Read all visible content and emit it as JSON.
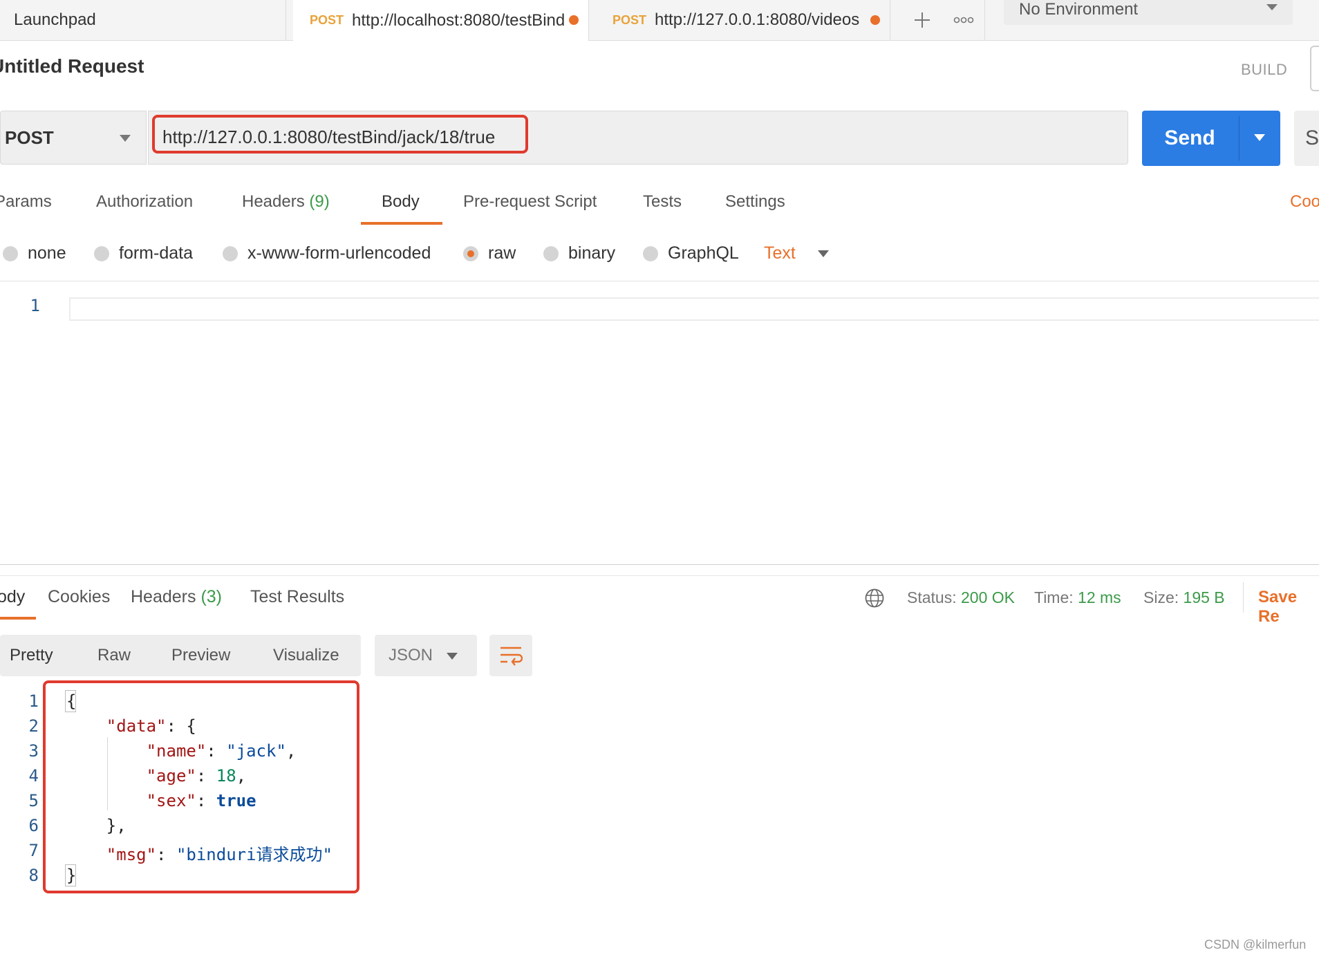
{
  "tabs": {
    "launchpad": "Launchpad",
    "items": [
      {
        "method": "POST",
        "url": "http://localhost:8080/testBind"
      },
      {
        "method": "POST",
        "url": "http://127.0.0.1:8080/videos"
      }
    ],
    "add_icon": "+",
    "more_icon": "ooo"
  },
  "environment": {
    "selected": "No Environment"
  },
  "request": {
    "title": "Untitled Request",
    "build_label": "BUILD",
    "method": "POST",
    "url": "http://127.0.0.1:8080/testBind/jack/18/true",
    "send_label": "Send",
    "save_label": "Sa",
    "tabs": [
      {
        "label": "Params"
      },
      {
        "label": "Authorization"
      },
      {
        "label": "Headers",
        "count": "(9)"
      },
      {
        "label": "Body"
      },
      {
        "label": "Pre-request Script"
      },
      {
        "label": "Tests"
      },
      {
        "label": "Settings"
      }
    ],
    "active_tab": "Body",
    "cookies_link": "Coo",
    "body_types": [
      "none",
      "form-data",
      "x-www-form-urlencoded",
      "raw",
      "binary",
      "GraphQL"
    ],
    "selected_body_type": "raw",
    "raw_format": "Text",
    "editor_line_numbers": [
      "1"
    ]
  },
  "response": {
    "tabs": [
      {
        "label": "ody"
      },
      {
        "label": "Cookies"
      },
      {
        "label": "Headers",
        "count": "(3)"
      },
      {
        "label": "Test Results"
      }
    ],
    "status_label": "Status:",
    "status_value": "200 OK",
    "time_label": "Time:",
    "time_value": "12 ms",
    "size_label": "Size:",
    "size_value": "195 B",
    "save_label": "Save Re",
    "views": [
      "Pretty",
      "Raw",
      "Preview",
      "Visualize"
    ],
    "active_view": "Pretty",
    "format": "JSON",
    "line_numbers": [
      "1",
      "2",
      "3",
      "4",
      "5",
      "6",
      "7",
      "8"
    ],
    "body": {
      "key_data": "\"data\"",
      "key_name": "\"name\"",
      "val_name": "\"jack\"",
      "key_age": "\"age\"",
      "val_age": "18",
      "key_sex": "\"sex\"",
      "val_sex": "true",
      "key_msg": "\"msg\"",
      "val_msg": "\"binduri请求成功\""
    }
  },
  "watermark": "CSDN @kilmerfun",
  "colors": {
    "accent": "#e8702a",
    "send": "#2b7ce3",
    "highlight": "#e03a2e",
    "success": "#3c9a4a"
  }
}
